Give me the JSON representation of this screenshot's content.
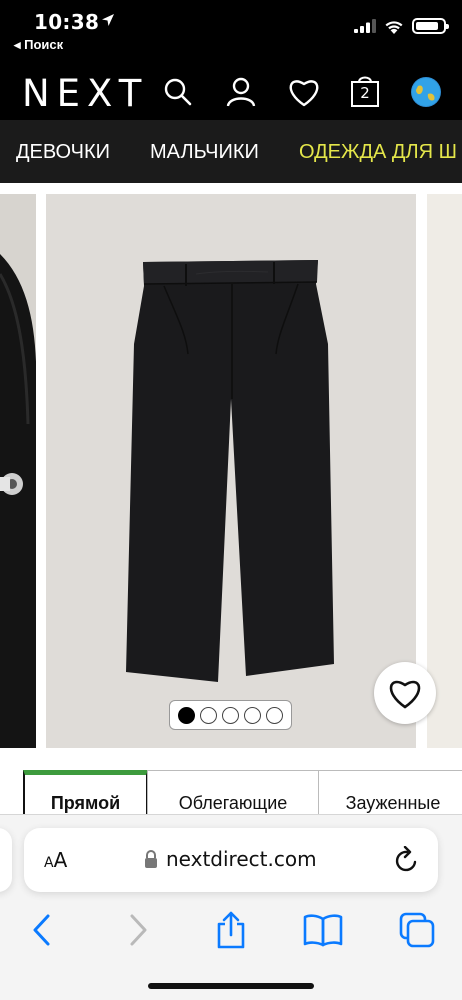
{
  "status_bar": {
    "time": "10:38",
    "back_label": "◂ Поиск",
    "battery_level": 0.86
  },
  "header": {
    "logo": "NEXT",
    "bag_count": "2"
  },
  "nav": {
    "items": [
      "ДЕВОЧКИ",
      "МАЛЬЧИКИ",
      "ОДЕЖДА ДЛЯ Ш"
    ]
  },
  "carousel": {
    "slide_count": 5,
    "active_index": 0
  },
  "fit_tabs": [
    "Прямой",
    "Облегающие",
    "Зауженные"
  ],
  "browser": {
    "aa_label_small": "A",
    "aa_label_big": "A",
    "url": "nextdirect.com"
  },
  "colors": {
    "nav_highlight": "#e4e64a",
    "active_tab_accent": "#3d9b3d",
    "ios_blue": "#0a7aff"
  }
}
